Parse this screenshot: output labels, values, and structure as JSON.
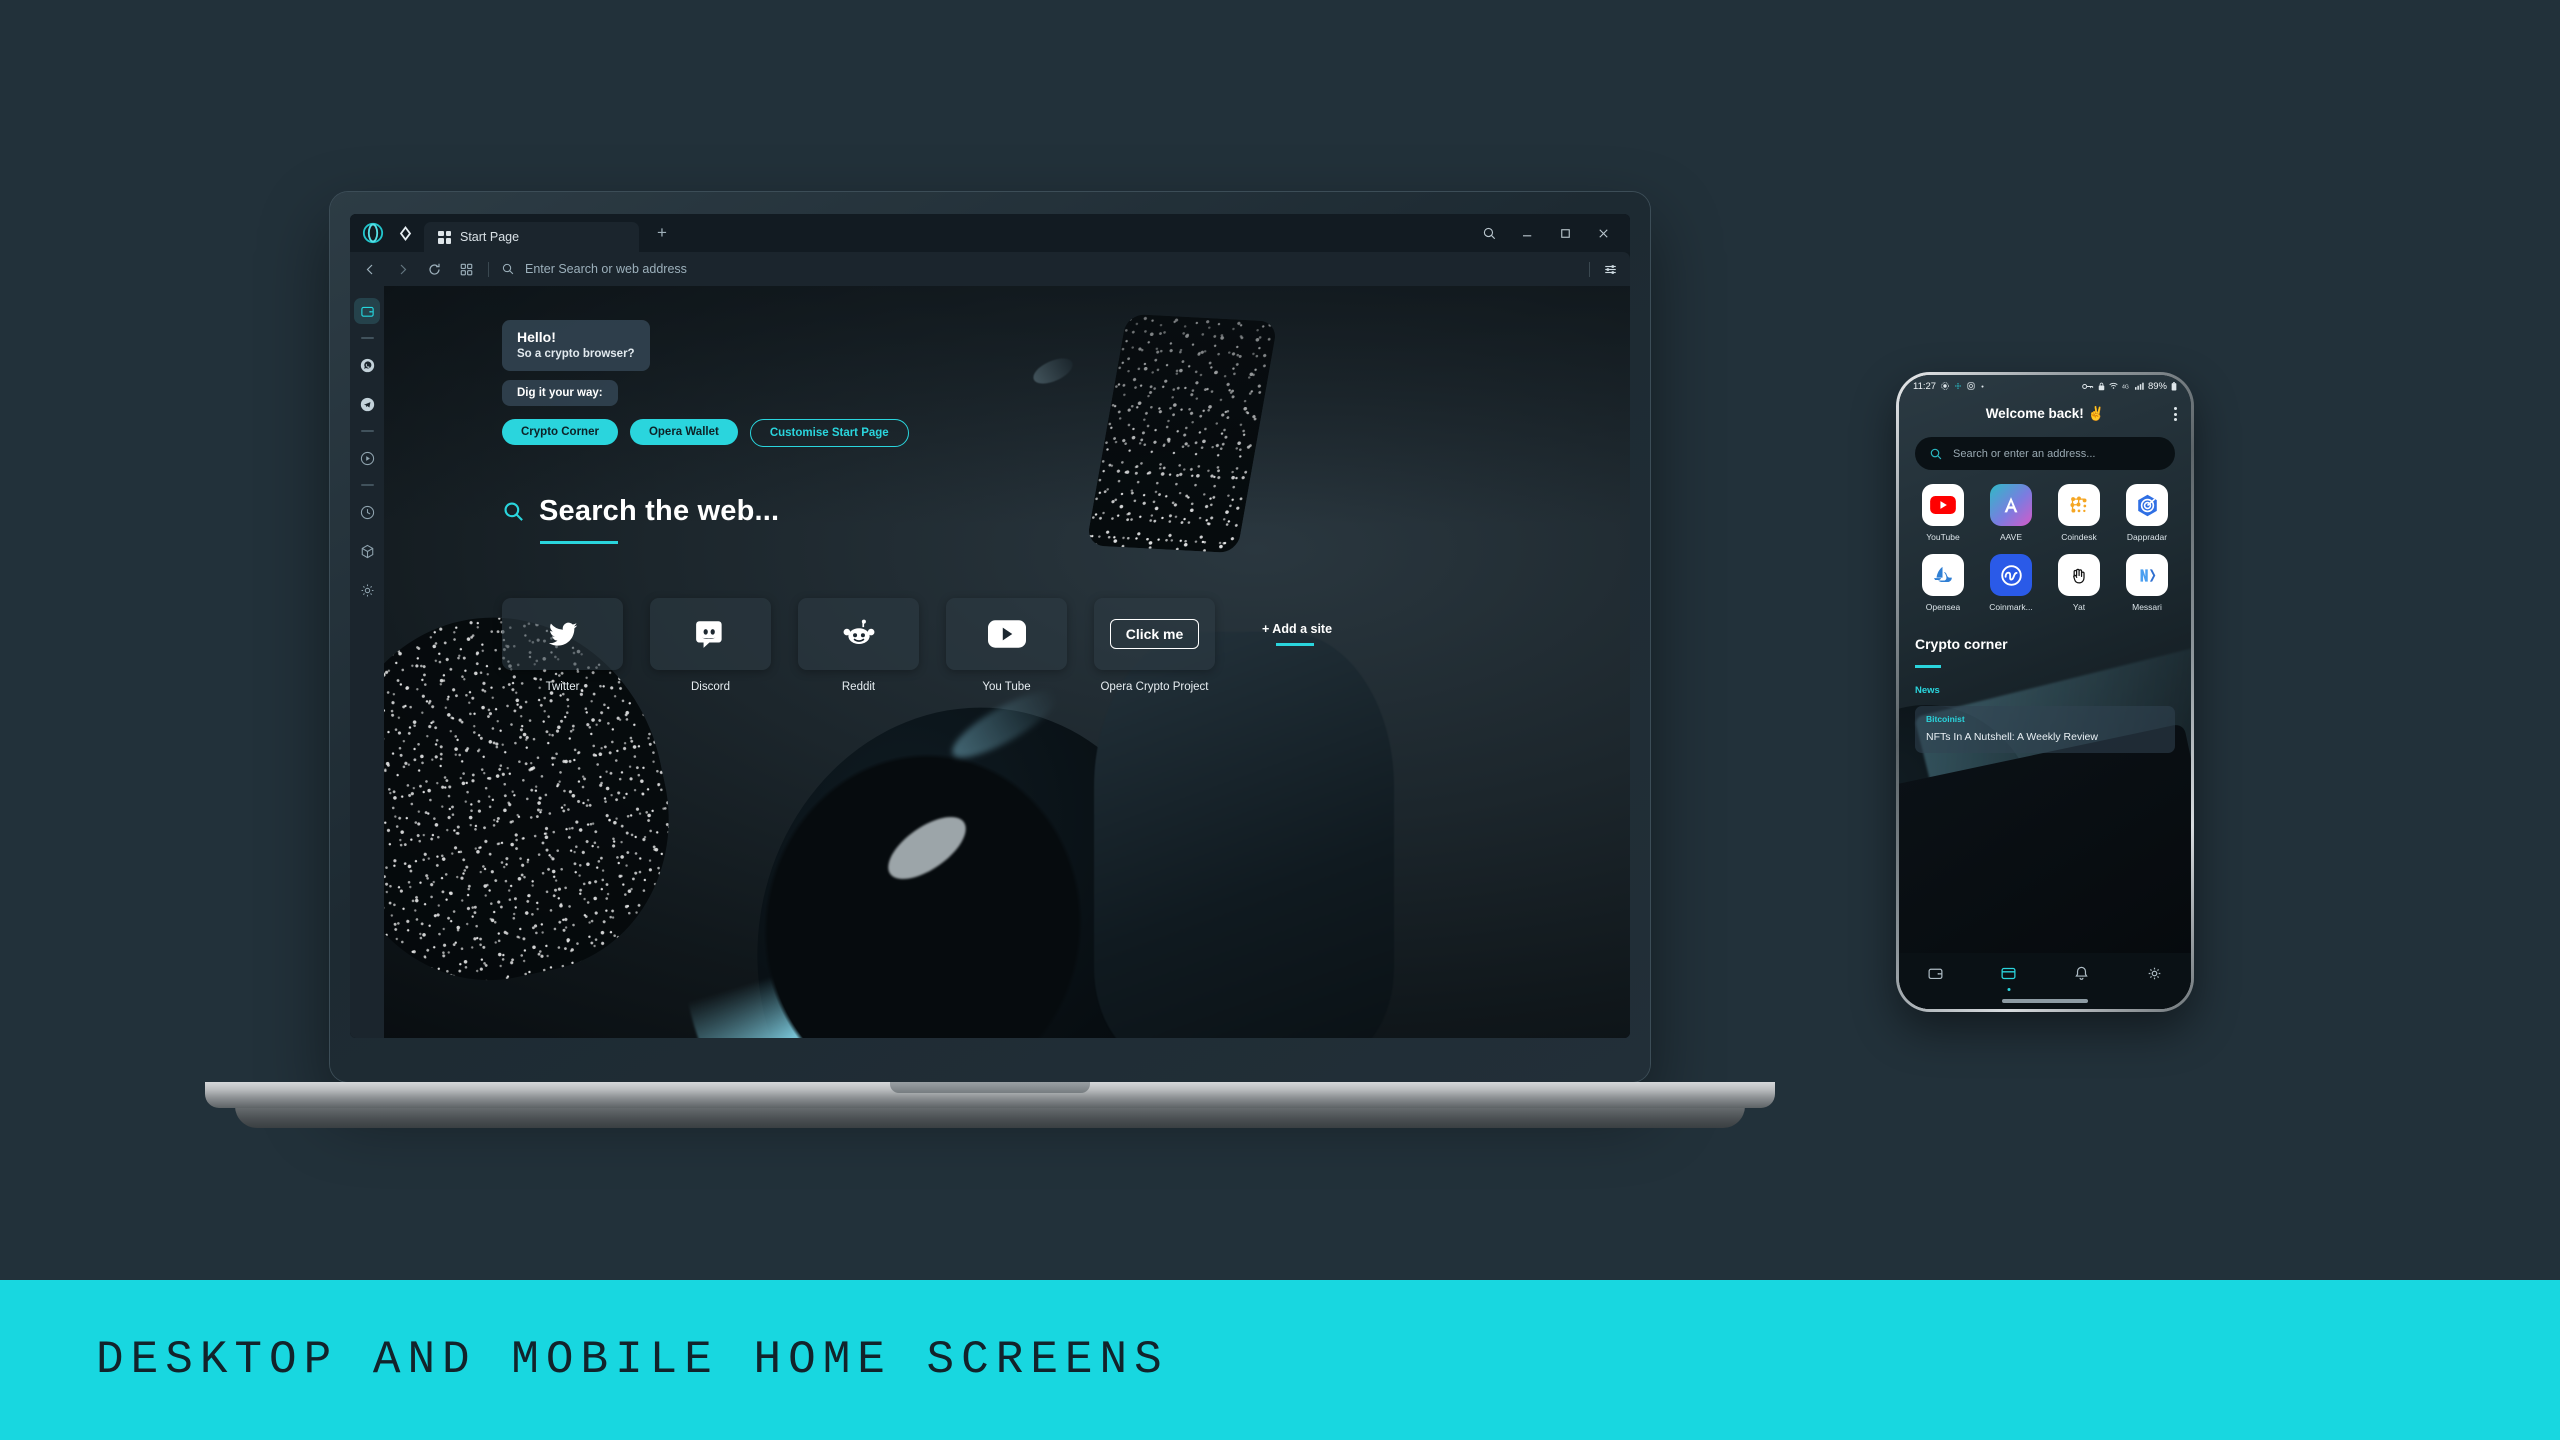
{
  "caption": {
    "text": "DESKTOP AND MOBILE HOME SCREENS",
    "bg_color": "#18d7e0",
    "text_color": "#12232b"
  },
  "accent_color": "#2ad5dd",
  "page_bg": "#22313a",
  "desktop": {
    "tabstrip": {
      "logo_icon": "opera-logo-icon",
      "workspace_icon": "rhombus-icon",
      "tabs": [
        {
          "icon": "grid-icon",
          "title": "Start Page"
        }
      ],
      "new_tab_label": "+",
      "window_controls": [
        {
          "name": "search-button",
          "glyph": "search-icon"
        },
        {
          "name": "minimize-button",
          "glyph": "minimize-icon"
        },
        {
          "name": "maximize-button",
          "glyph": "maximize-icon"
        },
        {
          "name": "close-button",
          "glyph": "close-icon"
        }
      ]
    },
    "toolbar": {
      "back_icon": "chevron-left-icon",
      "forward_icon": "chevron-right-icon",
      "reload_icon": "reload-icon",
      "tabmenu_icon": "tab-grid-icon",
      "search_icon": "search-icon",
      "address_placeholder": "Enter Search or web address",
      "easy_setup_icon": "sliders-icon"
    },
    "sidebar": [
      {
        "name": "sidebar-item-wallet",
        "icon": "wallet-icon",
        "active": true
      },
      {
        "name": "sidebar-divider-1",
        "icon": "divider",
        "active": false
      },
      {
        "name": "sidebar-item-whatsapp",
        "icon": "whatsapp-icon",
        "active": false
      },
      {
        "name": "sidebar-item-telegram",
        "icon": "telegram-icon",
        "active": false
      },
      {
        "name": "sidebar-divider-2",
        "icon": "divider",
        "active": false
      },
      {
        "name": "sidebar-item-player",
        "icon": "player-icon",
        "active": false
      },
      {
        "name": "sidebar-divider-3",
        "icon": "divider",
        "active": false
      },
      {
        "name": "sidebar-item-history",
        "icon": "clock-icon",
        "active": false
      },
      {
        "name": "sidebar-item-extensions",
        "icon": "cube-icon",
        "active": false
      },
      {
        "name": "sidebar-item-settings",
        "icon": "gear-icon",
        "active": false
      }
    ],
    "startpage": {
      "greeting_title": "Hello!",
      "greeting_subtitle": "So a crypto browser?",
      "dig_label": "Dig it your way:",
      "chips": [
        {
          "label": "Crypto Corner",
          "style": "solid"
        },
        {
          "label": "Opera Wallet",
          "style": "solid"
        },
        {
          "label": "Customise Start Page",
          "style": "ghost"
        }
      ],
      "search_heading": "Search the web...",
      "search_icon": "search-icon",
      "dials": [
        {
          "label": "Twitter",
          "icon": "twitter-icon"
        },
        {
          "label": "Discord",
          "icon": "discord-icon"
        },
        {
          "label": "Reddit",
          "icon": "reddit-icon"
        },
        {
          "label": "You Tube",
          "icon": "youtube-icon"
        },
        {
          "label": "Opera Crypto Project",
          "icon": "click-me-button",
          "button_label": "Click me"
        }
      ],
      "add_site_label": "+ Add a site"
    }
  },
  "mobile": {
    "status": {
      "time": "11:27",
      "left_icons": [
        "gear-icon",
        "puzzle-icon",
        "instagram-icon",
        "dot-icon"
      ],
      "right_icons": [
        "vpn-key-icon",
        "lock-icon",
        "wifi-icon",
        "4g-icon",
        "signal-icon"
      ],
      "battery": "89%",
      "battery_icon": "battery-icon"
    },
    "header": {
      "title": "Welcome back! ✌️",
      "menu_icon": "kebab-menu-icon"
    },
    "search": {
      "placeholder": "Search or enter an address...",
      "icon": "search-icon"
    },
    "apps": [
      {
        "label": "YouTube",
        "icon": "youtube-icon",
        "bg": "#ffffff"
      },
      {
        "label": "AAVE",
        "icon": "aave-icon",
        "bg": "linear-gradient(135deg,#2ebac6 0%,#7b7ce0 55%,#d45ac8 100%)"
      },
      {
        "label": "Coindesk",
        "icon": "coindesk-icon",
        "bg": "#ffffff"
      },
      {
        "label": "Dappradar",
        "icon": "dappradar-icon",
        "bg": "#ffffff"
      },
      {
        "label": "Opensea",
        "icon": "opensea-icon",
        "bg": "#ffffff"
      },
      {
        "label": "Coinmark...",
        "icon": "coinmarketcap-icon",
        "bg": "#2a5ae8"
      },
      {
        "label": "Yat",
        "icon": "yat-hand-icon",
        "bg": "#ffffff"
      },
      {
        "label": "Messari",
        "icon": "messari-icon",
        "bg": "#ffffff"
      }
    ],
    "crypto_corner": {
      "title": "Crypto corner",
      "section": "News",
      "card": {
        "source": "Bitcoinist",
        "headline": "NFTs In A Nutshell: A Weekly Review"
      }
    },
    "nav": [
      {
        "name": "nav-wallet",
        "icon": "wallet-icon",
        "active": false
      },
      {
        "name": "nav-browser",
        "icon": "browser-icon",
        "active": true
      },
      {
        "name": "nav-alerts",
        "icon": "bell-icon",
        "active": false
      },
      {
        "name": "nav-settings",
        "icon": "gear-icon",
        "active": false
      }
    ]
  }
}
